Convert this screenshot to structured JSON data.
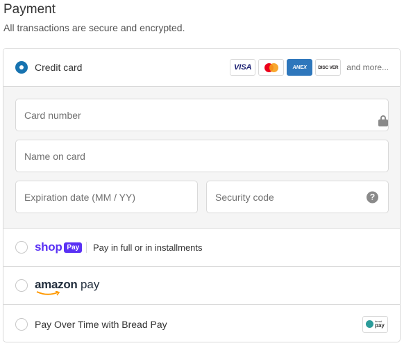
{
  "header": {
    "title": "Payment",
    "subtitle": "All transactions are secure and encrypted."
  },
  "methods": {
    "credit_card": {
      "label": "Credit card",
      "selected": true,
      "logos": [
        "visa-logo",
        "mastercard-logo",
        "amex-logo",
        "discover-logo"
      ],
      "visa_text": "VISA",
      "amex_text": "AMEX",
      "discover_text": "DISC VER",
      "more_label": "and more..."
    },
    "card_form": {
      "card_number": {
        "placeholder": "Card number",
        "value": "",
        "icon": "lock-icon"
      },
      "name_on_card": {
        "placeholder": "Name on card",
        "value": ""
      },
      "expiration": {
        "placeholder": "Expiration date (MM / YY)",
        "value": ""
      },
      "security_code": {
        "placeholder": "Security code",
        "value": "",
        "icon": "help-icon",
        "help_glyph": "?"
      }
    },
    "shop_pay": {
      "brand_word": "shop",
      "brand_badge": "Pay",
      "description": "Pay in full or in installments",
      "selected": false
    },
    "amazon_pay": {
      "brand_word": "amazon",
      "brand_pay": "pay",
      "selected": false
    },
    "bread_pay": {
      "label": "Pay Over Time with Bread Pay",
      "badge_small": "bread",
      "badge_text": "pay",
      "selected": false
    }
  },
  "colors": {
    "accent": "#1773b0",
    "shop_purple": "#5a31f4",
    "border": "#d9d9d9",
    "panel_bg": "#f5f5f5"
  }
}
